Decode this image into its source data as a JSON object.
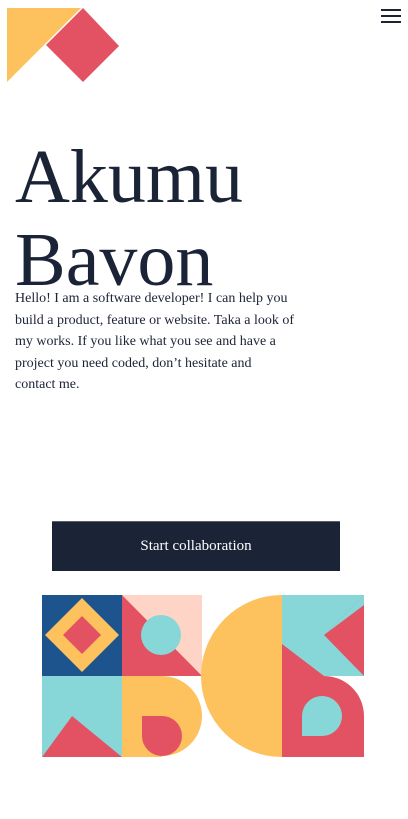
{
  "header": {
    "logo_icon": "geometric-logo-icon",
    "menu_icon": "hamburger-menu-icon"
  },
  "hero": {
    "title_line1": "Akumu",
    "title_line2": "Bavon",
    "intro": "Hello! I am a software developer! I can help you build a product, feature or website. Taka a look of my works. If you like what you see and have a project you need coded, don’t hesitate and contact me.",
    "cta_label": "Start collaboration"
  },
  "illustration": {
    "icon": "geometric-pattern-illustration"
  },
  "colors": {
    "navy": "#1b2336",
    "blue": "#1e548e",
    "yellow": "#fdc25e",
    "red": "#e25262",
    "teal": "#88d7d8",
    "pink": "#fdd4c6",
    "white": "#ffffff"
  }
}
